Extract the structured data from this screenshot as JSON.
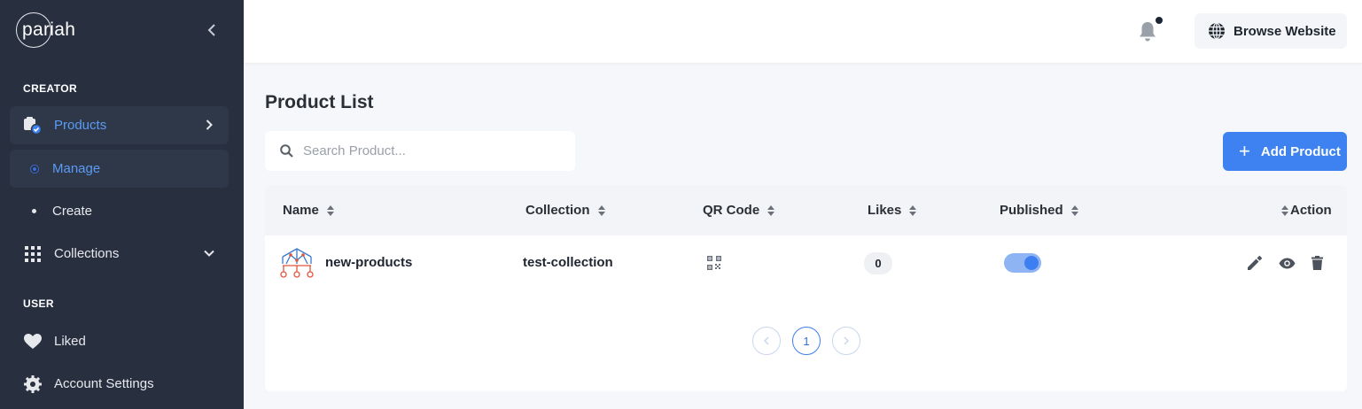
{
  "brand": {
    "name": "pariah"
  },
  "sidebar": {
    "creator_label": "CREATOR",
    "user_label": "USER",
    "items": [
      {
        "label": "Products",
        "icon": "products-icon"
      },
      {
        "label": "Manage",
        "icon": "dot-icon"
      },
      {
        "label": "Create",
        "icon": "dot-icon"
      },
      {
        "label": "Collections",
        "icon": "grid-icon"
      },
      {
        "label": "Liked",
        "icon": "heart-icon"
      },
      {
        "label": "Account Settings",
        "icon": "gear-icon"
      }
    ]
  },
  "header": {
    "browse_label": "Browse Website"
  },
  "main": {
    "title": "Product List",
    "search_placeholder": "Search Product...",
    "add_label": "Add Product",
    "columns": [
      "Name",
      "Collection",
      "QR Code",
      "Likes",
      "Published",
      "Action"
    ],
    "rows": [
      {
        "name": "new-products",
        "collection": "test-collection",
        "likes": "0",
        "published": true
      }
    ],
    "pagination": {
      "current": "1"
    }
  },
  "colors": {
    "sidebar_bg": "#283040",
    "accent": "#3d82f0",
    "active_text": "#5b9bf5"
  }
}
